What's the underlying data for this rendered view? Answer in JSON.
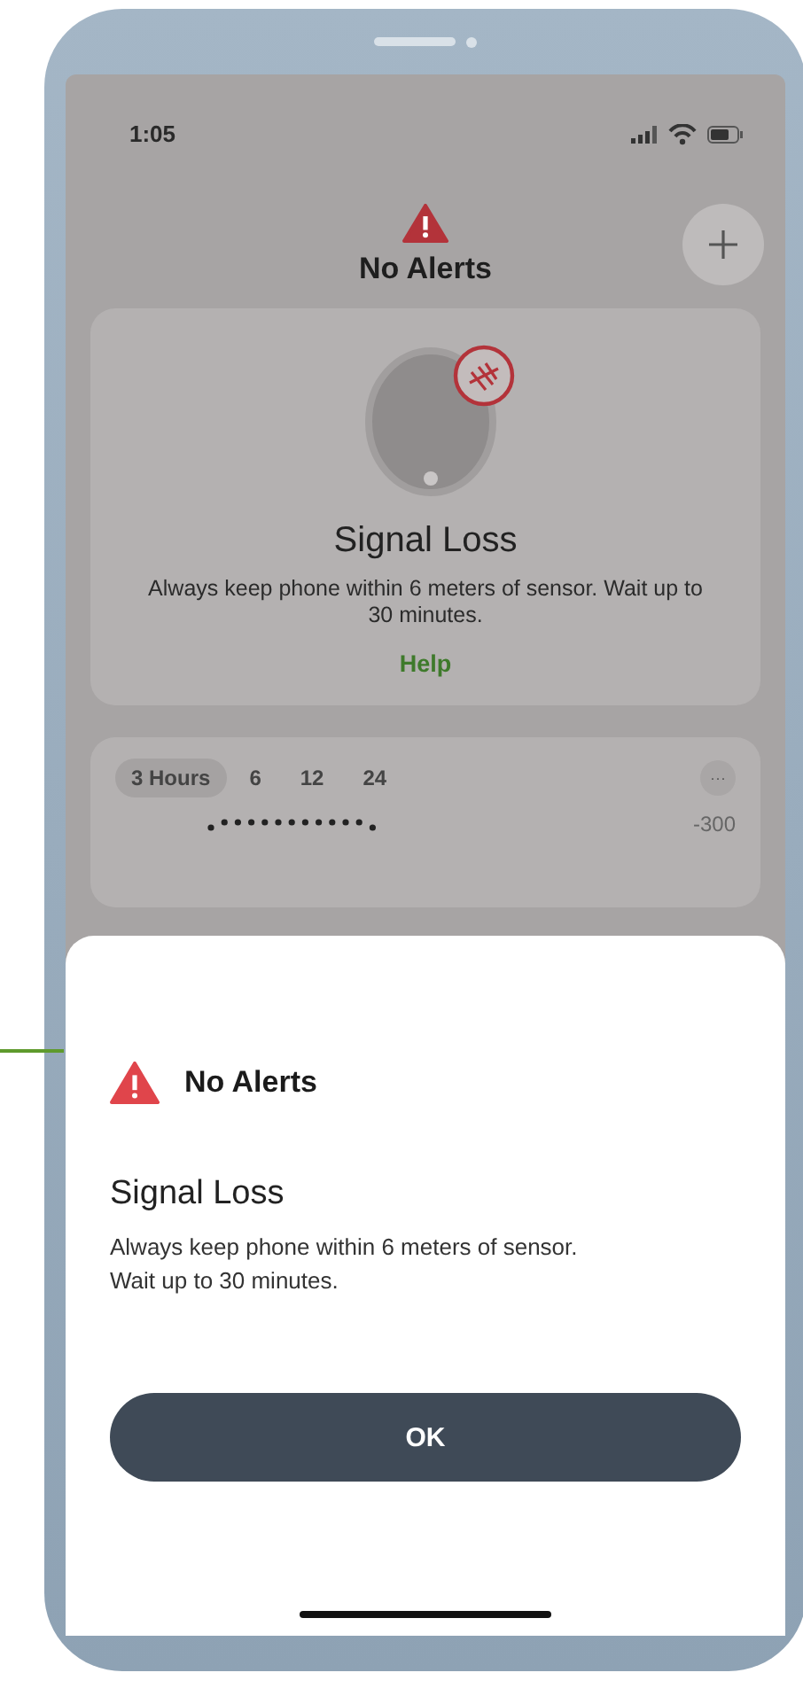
{
  "status_bar": {
    "time": "1:05"
  },
  "header": {
    "title": "No Alerts"
  },
  "alert_card": {
    "title": "Signal Loss",
    "message": "Always keep phone within 6 meters of sensor. Wait up to 30 minutes.",
    "link": "Help"
  },
  "graph_card": {
    "ranges": [
      {
        "label": "3 Hours",
        "selected": true
      },
      {
        "label": "6",
        "selected": false
      },
      {
        "label": "12",
        "selected": false
      },
      {
        "label": "24",
        "selected": false
      }
    ],
    "more": "···",
    "axis_label": "-300"
  },
  "sheet": {
    "header": "No Alerts",
    "title": "Signal Loss",
    "message": "Always keep phone within 6 meters of sensor.\nWait up to 30 minutes.",
    "button": "OK"
  }
}
